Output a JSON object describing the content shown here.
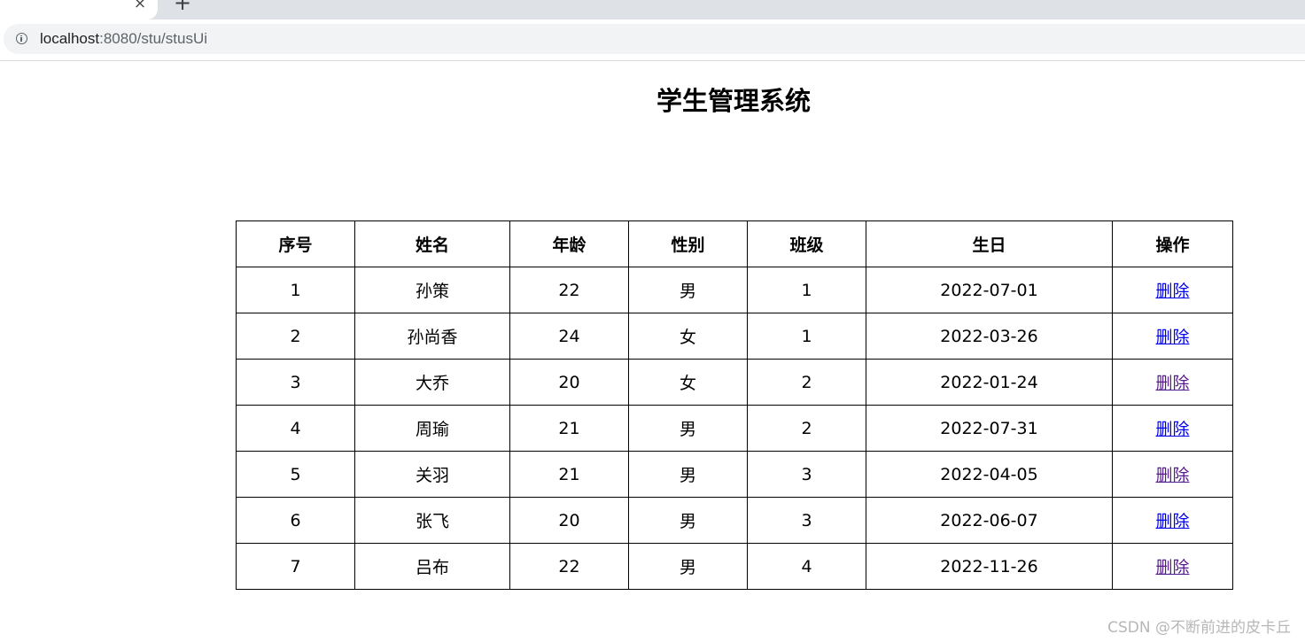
{
  "browser": {
    "tab_close_glyph": "×",
    "new_tab_glyph": "+",
    "url_host": "localhost",
    "url_rest": ":8080/stu/stusUi",
    "info_icon": "info-icon"
  },
  "page": {
    "title": "学生管理系统"
  },
  "table": {
    "headers": [
      "序号",
      "姓名",
      "年龄",
      "性别",
      "班级",
      "生日",
      "操作"
    ],
    "rows": [
      {
        "id": "1",
        "name": "孙策",
        "age": "22",
        "gender": "男",
        "class": "1",
        "birthday": "2022-07-01",
        "action": "删除",
        "link_color": "#0000ee"
      },
      {
        "id": "2",
        "name": "孙尚香",
        "age": "24",
        "gender": "女",
        "class": "1",
        "birthday": "2022-03-26",
        "action": "删除",
        "link_color": "#0000ee"
      },
      {
        "id": "3",
        "name": "大乔",
        "age": "20",
        "gender": "女",
        "class": "2",
        "birthday": "2022-01-24",
        "action": "删除",
        "link_color": "#551a8b"
      },
      {
        "id": "4",
        "name": "周瑜",
        "age": "21",
        "gender": "男",
        "class": "2",
        "birthday": "2022-07-31",
        "action": "删除",
        "link_color": "#0000ee"
      },
      {
        "id": "5",
        "name": "关羽",
        "age": "21",
        "gender": "男",
        "class": "3",
        "birthday": "2022-04-05",
        "action": "删除",
        "link_color": "#551a8b"
      },
      {
        "id": "6",
        "name": "张飞",
        "age": "20",
        "gender": "男",
        "class": "3",
        "birthday": "2022-06-07",
        "action": "删除",
        "link_color": "#0000ee"
      },
      {
        "id": "7",
        "name": "吕布",
        "age": "22",
        "gender": "男",
        "class": "4",
        "birthday": "2022-11-26",
        "action": "删除",
        "link_color": "#551a8b"
      }
    ]
  },
  "watermark": "CSDN @不断前进的皮卡丘"
}
